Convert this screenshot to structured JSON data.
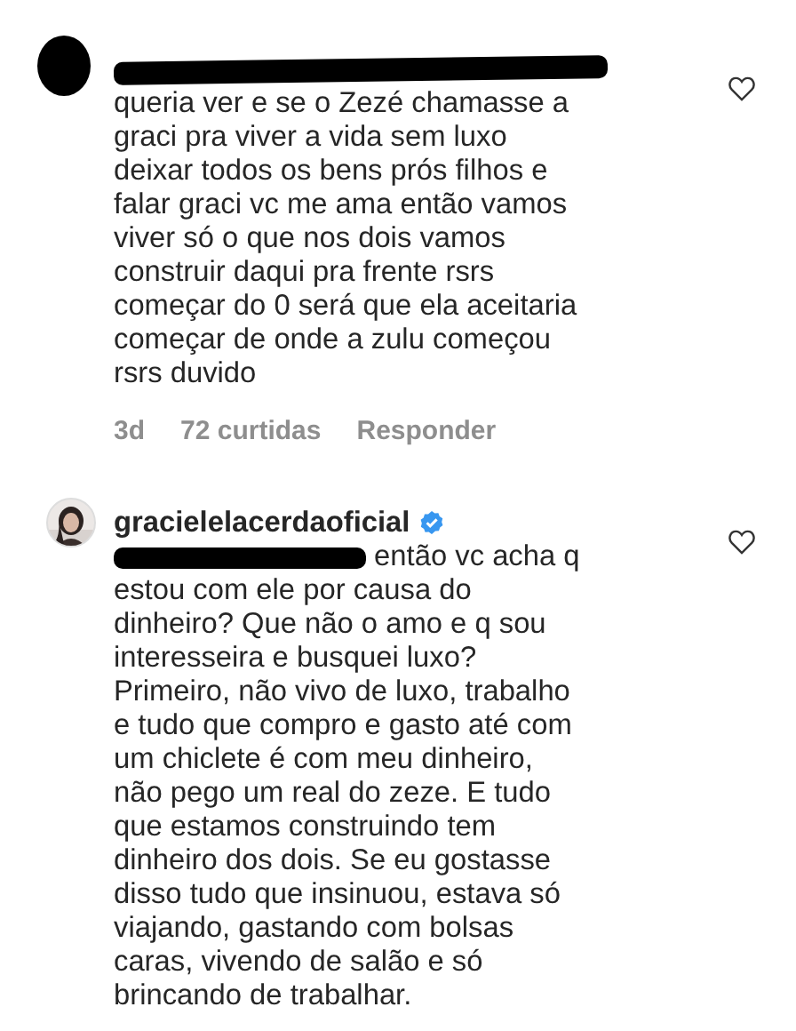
{
  "comments": [
    {
      "avatar": {
        "kind": "redacted"
      },
      "username_redacted": true,
      "text": "queria ver e se o Zezé chamasse a\ngraci pra viver a vida sem luxo\ndeixar todos os bens prós filhos e\nfalar graci vc me ama então vamos\nviver só o que nos dois vamos\nconstruir daqui pra frente rsrs\ncomeçar do 0 será que ela aceitaria\ncomeçar de onde a zulu começou\nrsrs duvido",
      "time": "3d",
      "likes": "72 curtidas",
      "reply_label": "Responder"
    },
    {
      "username": "gracielelacerdaoficial",
      "verified": true,
      "mention_redacted": true,
      "text": " então vc acha q\nestou com ele por causa do\ndinheiro? Que não o amo e q sou\ninteresseira e busquei luxo?\nPrimeiro, não vivo de luxo, trabalho\ne tudo que compro e gasto até com\num chiclete é com meu dinheiro,\nnão pego um real do zeze. E tudo\nque estamos construindo tem\ndinheiro dos dois. Se eu gostasse\ndisso tudo que insinuou, estava só\nviajando, gastando com bolsas\ncaras, vivendo de salão e só\nbrincando de trabalhar."
    }
  ]
}
